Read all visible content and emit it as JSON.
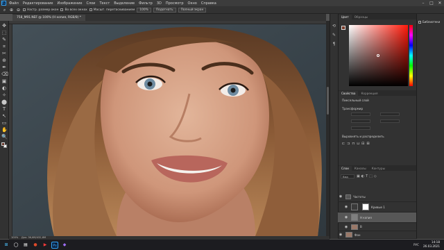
{
  "app": {
    "logo_text": "Ps",
    "menu": [
      "Файл",
      "Редактирование",
      "Изображение",
      "Слои",
      "Текст",
      "Выделение",
      "Фильтр",
      "3D",
      "Просмотр",
      "Окно",
      "Справка"
    ],
    "window_controls": [
      "–",
      "□",
      "✕"
    ]
  },
  "options_bar": {
    "tool_icon": "zoom-icon",
    "resize_windows_label": "Настр. размер окон",
    "all_windows_label": "Во всех окнах",
    "scrubby_zoom_label": "Масшт. перетаскиванием",
    "zoom_value": "100%",
    "fit_label": "Подогнать",
    "fill_label": "Полный экран"
  },
  "document": {
    "tab_title": "758_M91.NEF @ 100% (Н копия, RGB/8) *",
    "zoom_status": "100%",
    "doc_status": "Док: 36,6М/432,6М"
  },
  "toolbar": {
    "tools": [
      "✥",
      "⬚",
      "✎",
      "⌗",
      "✂",
      "⊕",
      "✒",
      "⌫",
      "▣",
      "◐",
      "✧",
      "⬤",
      "T",
      "↖",
      "▭",
      "✋",
      "🔍"
    ]
  },
  "color_panel": {
    "tabs": [
      "Цвет",
      "Образцы"
    ],
    "active_tab": "Цвет",
    "foreground_color": "#7a3d2c",
    "background_color": "#ffffff"
  },
  "far_right": {
    "libraries_label": "Библиотеки"
  },
  "properties_panel": {
    "tabs": [
      "Свойства",
      "Коррекция"
    ],
    "subtitle": "Пиксельный слой",
    "transform_label": "Трансформир",
    "align_label": "Выровнять и распределить"
  },
  "layers_panel": {
    "tabs": [
      "Слои",
      "Каналы",
      "Контуры"
    ],
    "search_placeholder": "Вид",
    "layers": [
      {
        "name": "Частоты",
        "type": "group",
        "visible": true,
        "selected": false
      },
      {
        "name": "Кривые 1",
        "type": "adjustment",
        "visible": true,
        "selected": false
      },
      {
        "name": "Н копия",
        "type": "pixel",
        "visible": true,
        "selected": true
      },
      {
        "name": "В",
        "type": "pixel",
        "visible": true,
        "selected": false
      },
      {
        "name": "Фон",
        "type": "pixel",
        "visible": true,
        "selected": false
      }
    ]
  },
  "taskbar": {
    "apps": [
      "⊞",
      "◯",
      "▤",
      "●",
      "▶",
      "Ps",
      "◆"
    ],
    "tray_text": "РУС",
    "time": "14:18",
    "date": "26.03.2021"
  }
}
